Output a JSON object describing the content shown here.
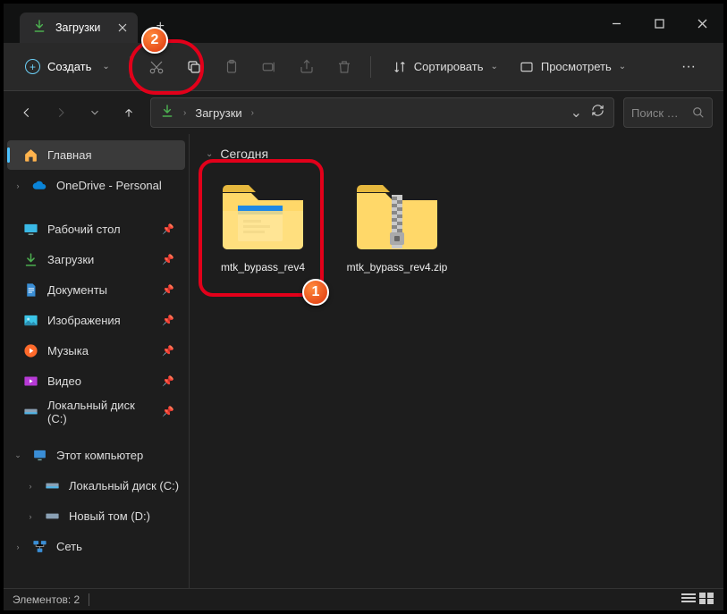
{
  "tab": {
    "label": "Загрузки"
  },
  "toolbar": {
    "create": "Создать",
    "sort": "Сортировать",
    "view": "Просмотреть"
  },
  "breadcrumb": {
    "current": "Загрузки"
  },
  "search": {
    "placeholder": "Поиск …"
  },
  "sidebar": {
    "home": "Главная",
    "onedrive": "OneDrive - Personal",
    "desktop": "Рабочий стол",
    "downloads": "Загрузки",
    "documents": "Документы",
    "pictures": "Изображения",
    "music": "Музыка",
    "videos": "Видео",
    "localC": "Локальный диск (C:)",
    "thisPC": "Этот компьютер",
    "localC2": "Локальный диск (C:)",
    "newVol": "Новый том (D:)",
    "network": "Сеть"
  },
  "group": {
    "today": "Сегодня"
  },
  "files": {
    "folder": "mtk_bypass_rev4",
    "zip": "mtk_bypass_rev4.zip"
  },
  "status": {
    "elements": "Элементов: 2"
  },
  "annotations": {
    "one": "1",
    "two": "2"
  }
}
